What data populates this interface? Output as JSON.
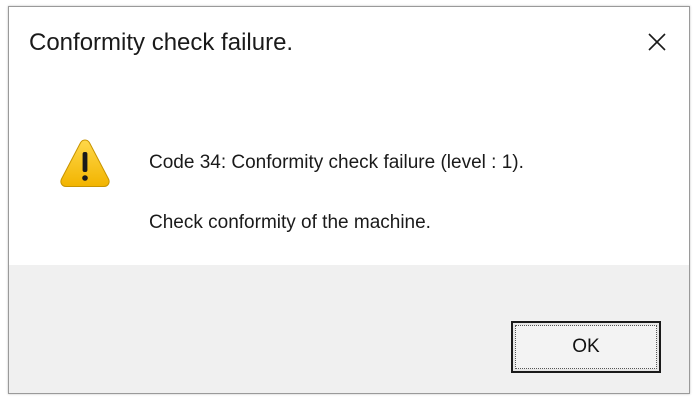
{
  "dialog": {
    "title": "Conformity check failure.",
    "close_icon": "close-icon",
    "icon": "warning-icon",
    "message_line1": "Code 34: Conformity check failure (level : 1).",
    "message_line2": "Check conformity of the machine.",
    "ok_label": "OK"
  },
  "colors": {
    "warning_fill": "#f7c21a",
    "footer_bg": "#f0f0f0",
    "text": "#1a1a1a"
  }
}
